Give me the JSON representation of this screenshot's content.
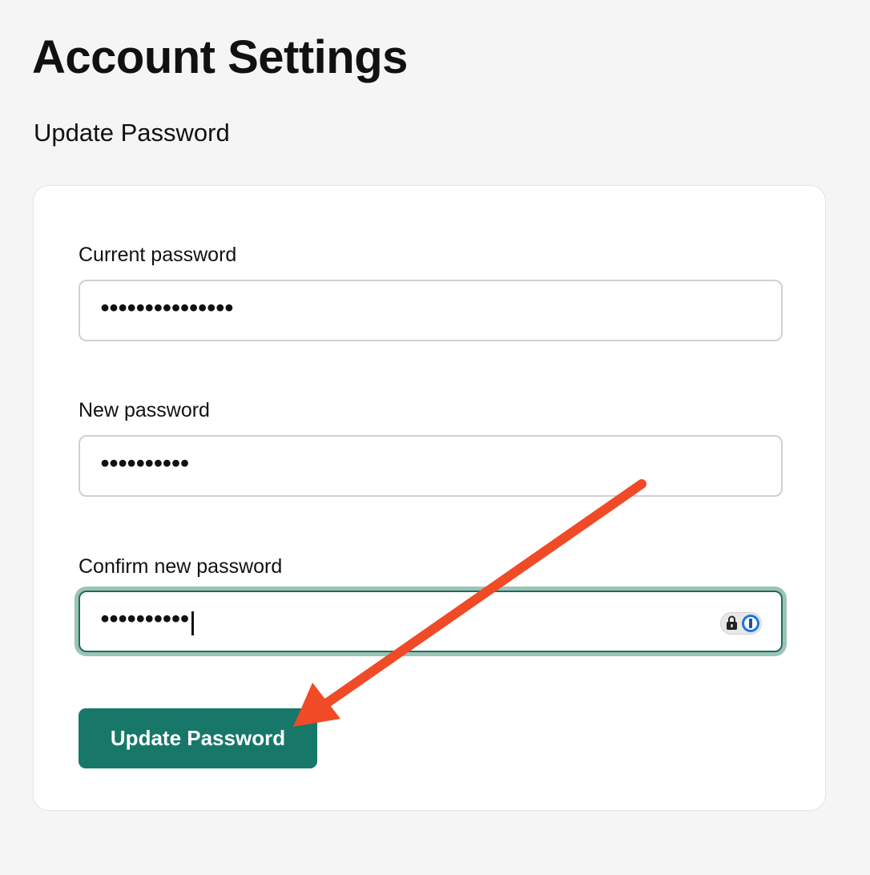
{
  "page": {
    "title": "Account Settings"
  },
  "section": {
    "title": "Update Password"
  },
  "form": {
    "current_password": {
      "label": "Current password",
      "masked_value": "•••••••••••••••"
    },
    "new_password": {
      "label": "New password",
      "masked_value": "••••••••••"
    },
    "confirm_password": {
      "label": "Confirm new password",
      "masked_value": "••••••••••",
      "focused": true
    },
    "submit_label": "Update Password"
  },
  "annotation": {
    "type": "arrow",
    "color": "#f04a26",
    "points_to": "update-password-button"
  },
  "colors": {
    "background": "#f4f5f4",
    "card": "#ffffff",
    "accent": "#17786a",
    "focus_ring": "#9cc3b8",
    "password_manager": "#1a73e8"
  },
  "icons": {
    "password_manager": "lock-icon"
  }
}
